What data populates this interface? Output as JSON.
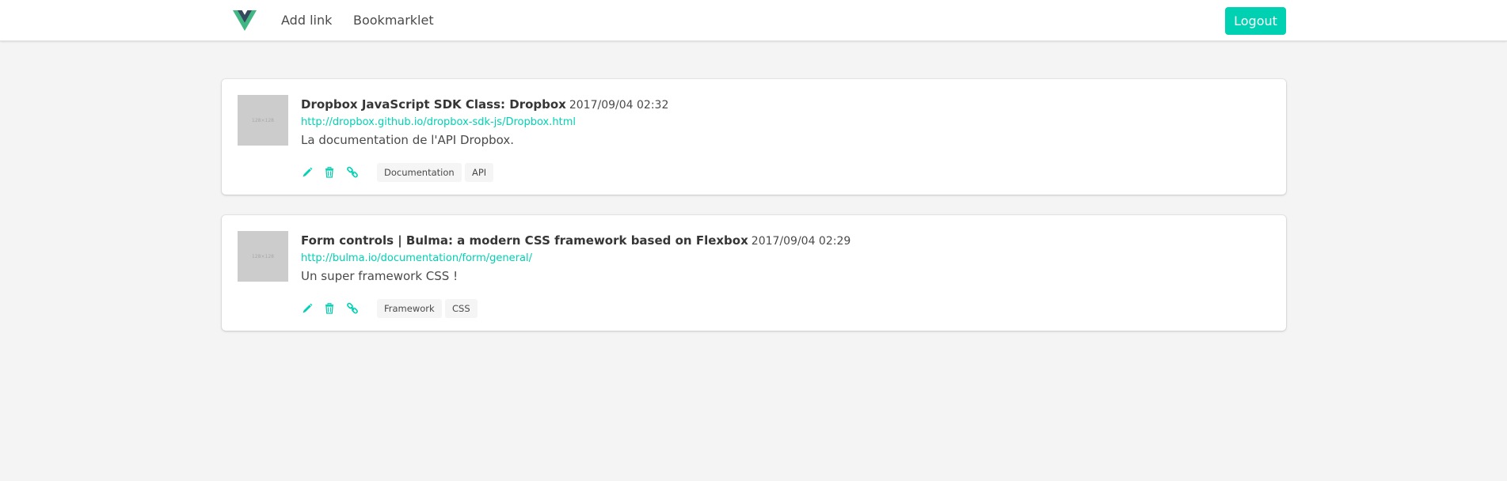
{
  "nav": {
    "logo": "vue-logo-icon",
    "add_link": "Add link",
    "bookmarklet": "Bookmarklet",
    "logout": "Logout"
  },
  "colors": {
    "accent": "#00d1b2",
    "logo_green": "#41b883",
    "logo_dark": "#35495e",
    "background": "#f4f4f4"
  },
  "links": [
    {
      "thumbnail_text": "128×128",
      "title": "Dropbox JavaScript SDK Class: Dropbox",
      "date": "2017/09/04 02:32",
      "url": "http://dropbox.github.io/dropbox-sdk-js/Dropbox.html",
      "description": "La documentation de l'API Dropbox.",
      "tags": [
        "Documentation",
        "API"
      ]
    },
    {
      "thumbnail_text": "128×128",
      "title": "Form controls | Bulma: a modern CSS framework based on Flexbox",
      "date": "2017/09/04 02:29",
      "url": "http://bulma.io/documentation/form/general/",
      "description": "Un super framework CSS !",
      "tags": [
        "Framework",
        "CSS"
      ]
    }
  ],
  "icons": {
    "edit": "pencil-icon",
    "delete": "trash-icon",
    "open": "link-icon"
  }
}
